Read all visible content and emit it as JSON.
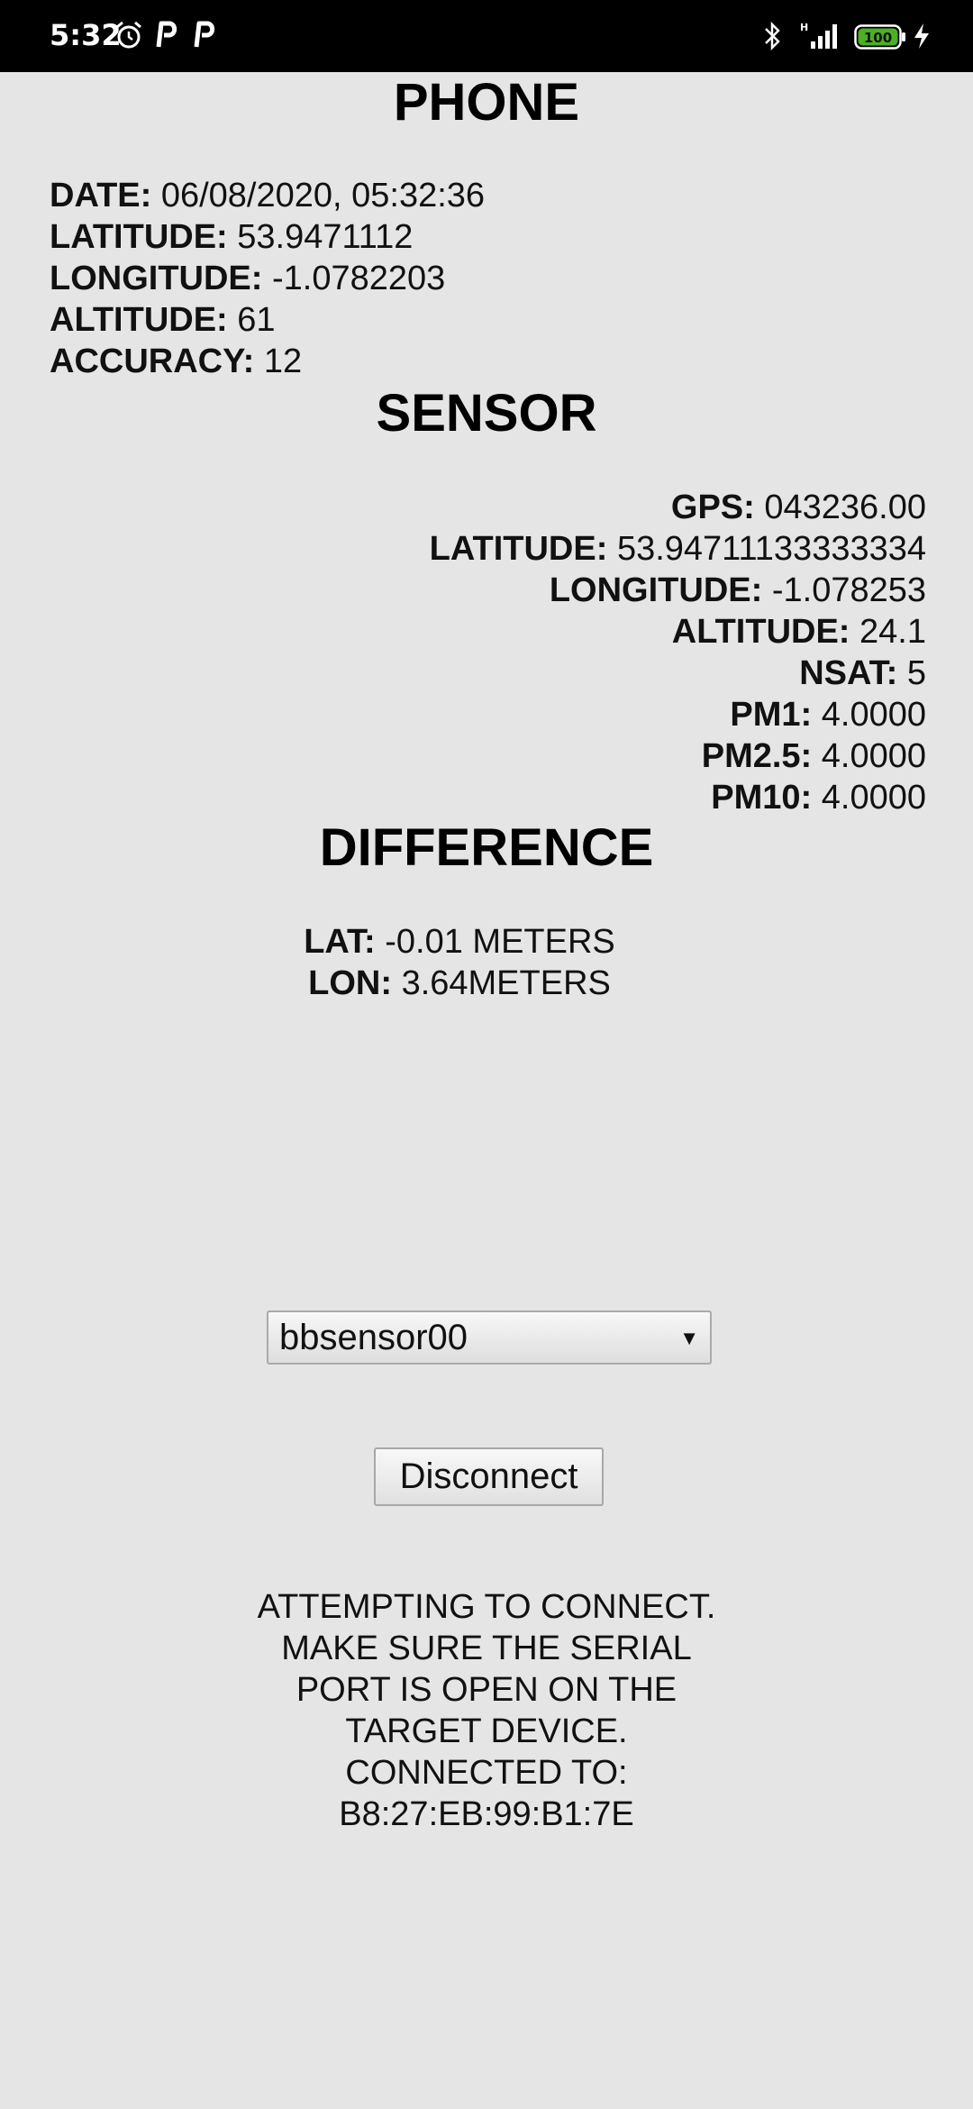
{
  "status_bar": {
    "time": "5:32",
    "battery_level": "100",
    "icons": [
      "alarm-icon",
      "p-notification-icon",
      "p-notification-icon",
      "bluetooth-icon",
      "signal-icon",
      "battery-icon",
      "charging-icon"
    ],
    "battery_color": "#4caf24"
  },
  "phone": {
    "title": "PHONE",
    "rows": [
      {
        "label": "DATE:",
        "value": "06/08/2020, 05:32:36"
      },
      {
        "label": "LATITUDE:",
        "value": "53.9471112"
      },
      {
        "label": "LONGITUDE:",
        "value": "-1.0782203"
      },
      {
        "label": "ALTITUDE:",
        "value": "61"
      },
      {
        "label": "ACCURACY:",
        "value": "12"
      }
    ]
  },
  "sensor": {
    "title": "SENSOR",
    "rows": [
      {
        "label": "GPS:",
        "value": "043236.00"
      },
      {
        "label": "LATITUDE:",
        "value": "53.94711133333334"
      },
      {
        "label": "LONGITUDE:",
        "value": "-1.078253"
      },
      {
        "label": "ALTITUDE:",
        "value": "24.1"
      },
      {
        "label": "NSAT:",
        "value": "5"
      },
      {
        "label": "PM1:",
        "value": "4.0000"
      },
      {
        "label": "PM2.5:",
        "value": "4.0000"
      },
      {
        "label": "PM10:",
        "value": "4.0000"
      }
    ]
  },
  "difference": {
    "title": "DIFFERENCE",
    "rows": [
      {
        "label": "LAT:",
        "value": "-0.01 METERS"
      },
      {
        "label": "LON:",
        "value": "3.64METERS"
      }
    ]
  },
  "device_select": {
    "selected": "bbsensor00"
  },
  "disconnect_button": {
    "label": "Disconnect"
  },
  "status_message": {
    "lines": [
      "ATTEMPTING TO CONNECT.",
      "MAKE SURE THE SERIAL",
      "PORT IS OPEN ON THE",
      "TARGET DEVICE.",
      "CONNECTED TO:",
      "B8:27:EB:99:B1:7E"
    ]
  }
}
